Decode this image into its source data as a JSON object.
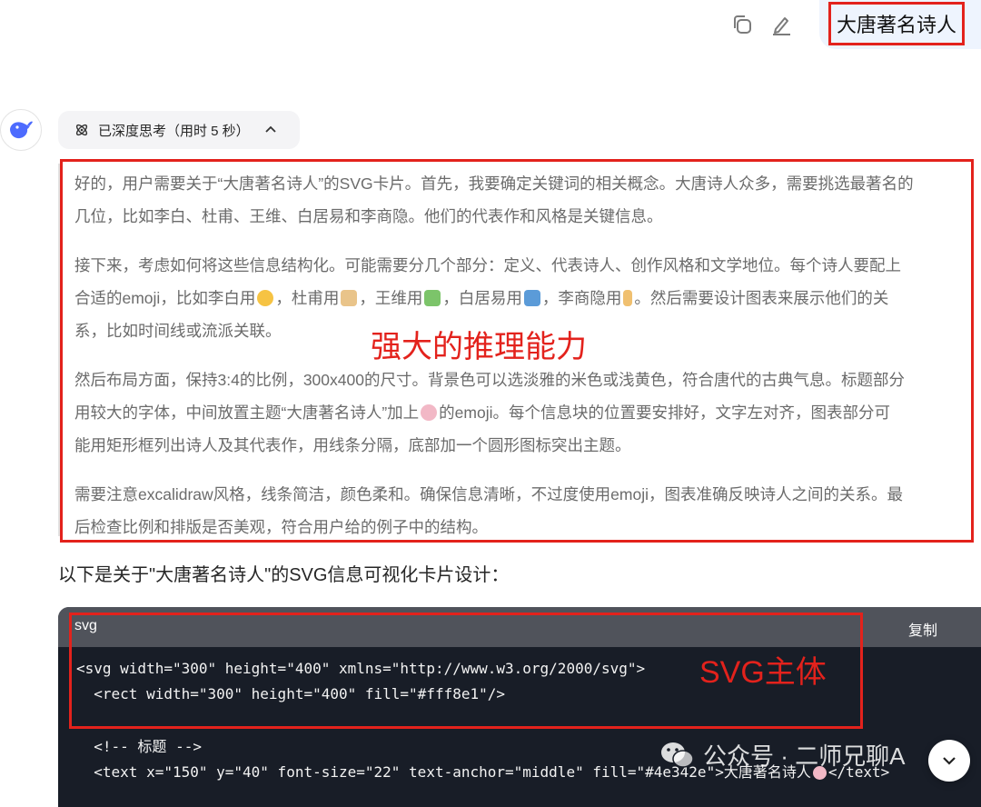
{
  "user_message": {
    "text": "大唐著名诗人"
  },
  "thinking": {
    "label": "已深度思考（用时 5 秒）"
  },
  "reasoning": {
    "lines": [
      [
        "好的，用户需要关于“大唐著名诗人”的SVG卡片。首先，我要确定关键词的相关概念。大唐诗人众多，需要挑选最著名的",
        "几位，比如李白、杜甫、王维、白居易和李商隐。他们的代表作和风格是关键信息。"
      ],
      [
        "接下来，考虑如何将这些信息结构化。可能需要分几个部分：定义、代表诗人、创作风格和文学地位。每个诗人要配上"
      ],
      [
        "然后布局方面，保持3:4的比例，300x400的尺寸。背景色可以选淡雅的米色或浅黄色，符合唐代的古典气息。标题部分",
        "用较大的字体，中间放置主题“大唐著名诗人”加上",
        "的emoji。每个信息块的位置要安排好，文字左对齐，图表部分可",
        "能用矩形框列出诗人及其代表作，用线条分隔，底部加一个圆形图标突出主题。"
      ],
      [
        "需要注意excalidraw风格，线条简洁，颜色柔和。确保信息清晰，不过度使用emoji，图表准确反映诗人之间的关系。最",
        "后检查比例和排版是否美观，符合用户给的例子中的结构。"
      ]
    ],
    "p2_line2": {
      "t1": "合适的emoji，比如李白用",
      "t2": "，杜甫用",
      "t3": "，王维用",
      "t4": "，白居易用",
      "t5": "，李商隐用",
      "t6": "。然后需要设计图表来展示他们的关"
    },
    "p2_line3": "系，比如时间线或流派关联。"
  },
  "annotations": {
    "reasoning": "强大的推理能力",
    "svg": "SVG主体"
  },
  "intro": "以下是关于\"大唐著名诗人\"的SVG信息可视化卡片设计：",
  "code": {
    "lang": "svg",
    "copy_label": "复制",
    "lines": [
      "<svg width=\"300\" height=\"400\" xmlns=\"http://www.w3.org/2000/svg\">",
      "  <rect width=\"300\" height=\"400\" fill=\"#fff8e1\"/>",
      "  <!-- 标题 -->",
      "  <text x=\"150\" y=\"40\" font-size=\"22\" text-anchor=\"middle\" fill=\"#4e342e\">大唐著名诗人"
    ],
    "line4_tail": "</text>"
  },
  "watermark": "公众号 · 二师兄聊A",
  "colors": {
    "annotation": "#e3221c",
    "code_bg": "#181d27",
    "code_header": "#50535b",
    "user_bubble": "#eef4fe"
  },
  "icons": [
    "copy-icon",
    "edit-icon",
    "deepseek-whale-icon",
    "atom-icon",
    "chevron-up-icon",
    "wechat-icon",
    "chevron-down-icon"
  ]
}
